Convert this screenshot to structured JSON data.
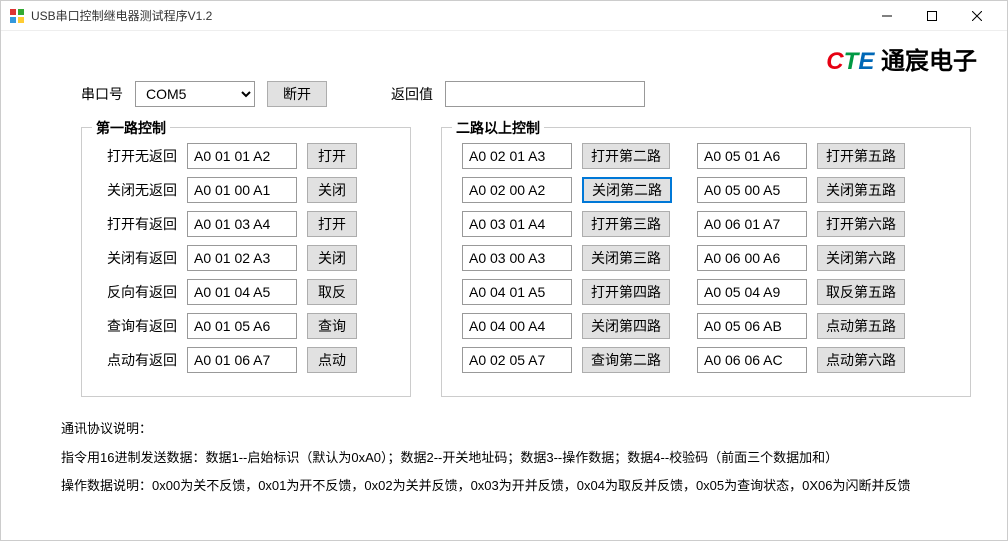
{
  "window": {
    "title": "USB串口控制继电器测试程序V1.2"
  },
  "logo": {
    "c": "C",
    "t": "T",
    "e": "E",
    "text": "通宸电子"
  },
  "topbar": {
    "port_label": "串口号",
    "port_value": "COM5",
    "disconnect_btn": "断开",
    "return_label": "返回值",
    "return_value": ""
  },
  "group1": {
    "title": "第一路控制",
    "rows": [
      {
        "label": "打开无返回",
        "cmd": "A0 01 01 A2",
        "btn": "打开"
      },
      {
        "label": "关闭无返回",
        "cmd": "A0 01 00 A1",
        "btn": "关闭"
      },
      {
        "label": "打开有返回",
        "cmd": "A0 01 03 A4",
        "btn": "打开"
      },
      {
        "label": "关闭有返回",
        "cmd": "A0 01 02 A3",
        "btn": "关闭"
      },
      {
        "label": "反向有返回",
        "cmd": "A0 01 04 A5",
        "btn": "取反"
      },
      {
        "label": "查询有返回",
        "cmd": "A0 01 05 A6",
        "btn": "查询"
      },
      {
        "label": "点动有返回",
        "cmd": "A0 01 06 A7",
        "btn": "点动"
      }
    ]
  },
  "group2": {
    "title": "二路以上控制",
    "col1": [
      {
        "cmd": "A0 02 01 A3",
        "btn": "打开第二路"
      },
      {
        "cmd": "A0 02 00 A2",
        "btn": "关闭第二路",
        "highlighted": true
      },
      {
        "cmd": "A0 03 01 A4",
        "btn": "打开第三路"
      },
      {
        "cmd": "A0 03 00 A3",
        "btn": "关闭第三路"
      },
      {
        "cmd": "A0 04 01 A5",
        "btn": "打开第四路"
      },
      {
        "cmd": "A0 04 00 A4",
        "btn": "关闭第四路"
      },
      {
        "cmd": "A0 02 05 A7",
        "btn": "查询第二路"
      }
    ],
    "col2": [
      {
        "cmd": "A0 05 01 A6",
        "btn": "打开第五路"
      },
      {
        "cmd": "A0 05 00 A5",
        "btn": "关闭第五路"
      },
      {
        "cmd": "A0 06 01 A7",
        "btn": "打开第六路"
      },
      {
        "cmd": "A0 06 00 A6",
        "btn": "关闭第六路"
      },
      {
        "cmd": "A0 05 04 A9",
        "btn": "取反第五路"
      },
      {
        "cmd": "A0 05 06 AB",
        "btn": "点动第五路"
      },
      {
        "cmd": "A0 06 06 AC",
        "btn": "点动第六路"
      }
    ]
  },
  "notes": {
    "line1": "通讯协议说明：",
    "line2": "指令用16进制发送数据：数据1--启始标识（默认为0xA0）；数据2--开关地址码；数据3--操作数据；数据4--校验码（前面三个数据加和）",
    "line3": "操作数据说明：0x00为关不反馈，0x01为开不反馈，0x02为关并反馈，0x03为开并反馈，0x04为取反并反馈，0x05为查询状态，0X06为闪断并反馈"
  }
}
